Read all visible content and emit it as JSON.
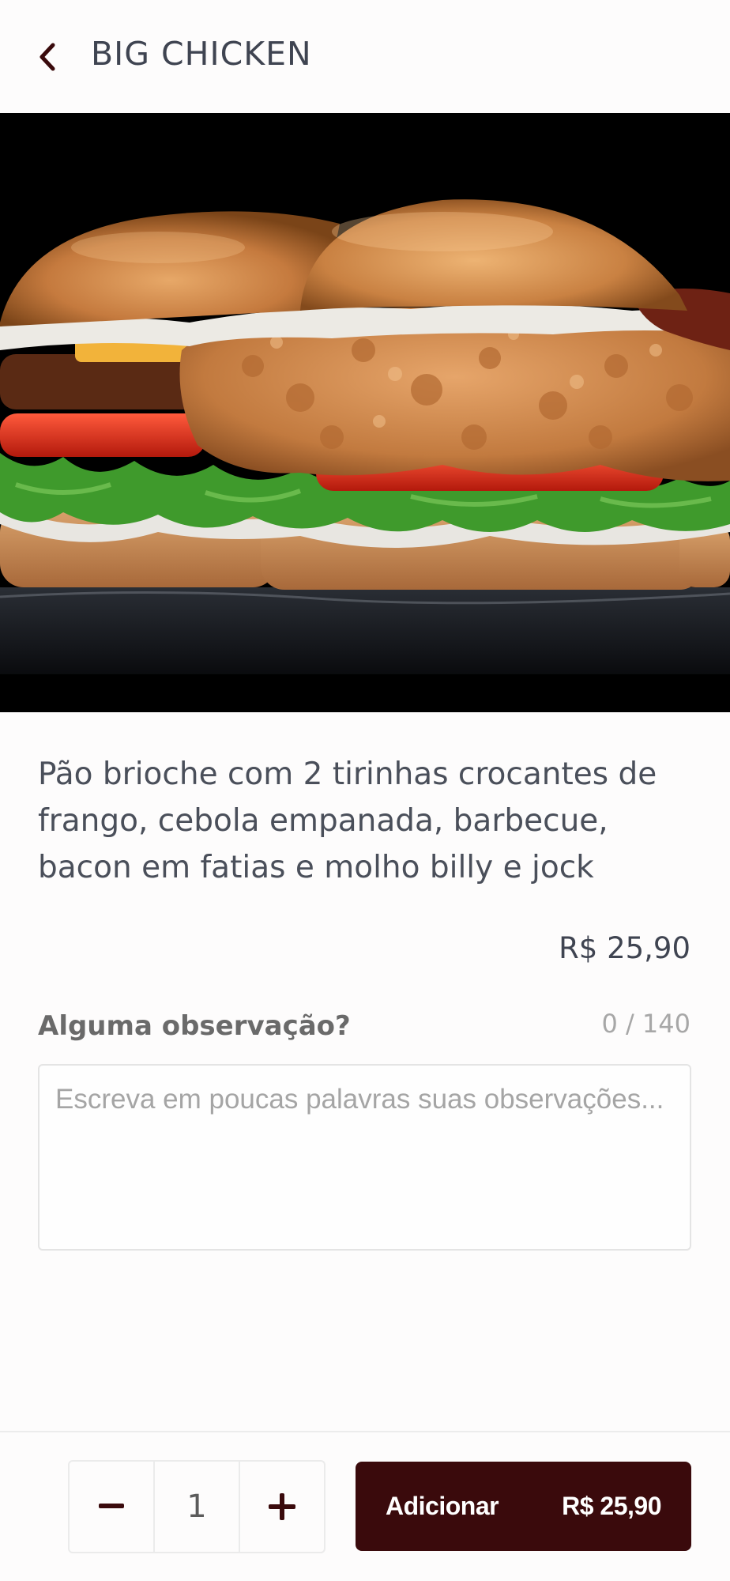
{
  "header": {
    "title": "BIG CHICKEN",
    "back_icon": "chevron-left-icon"
  },
  "product": {
    "image_alt": "",
    "description": "Pão brioche com 2 tirinhas crocantes de frango, cebola empanada, barbecue, bacon em fatias e molho billy e jock",
    "price": "R$ 25,90"
  },
  "notes": {
    "label": "Alguma observação?",
    "counter": "0 / 140",
    "placeholder": "Escreva em poucas palavras suas observações...",
    "value": ""
  },
  "footer": {
    "quantity": "1",
    "decrement_icon": "minus-icon",
    "increment_icon": "plus-icon",
    "add_label": "Adicionar",
    "add_price": "R$ 25,90"
  },
  "colors": {
    "accent": "#3a0a0c",
    "text": "#3f4451"
  }
}
